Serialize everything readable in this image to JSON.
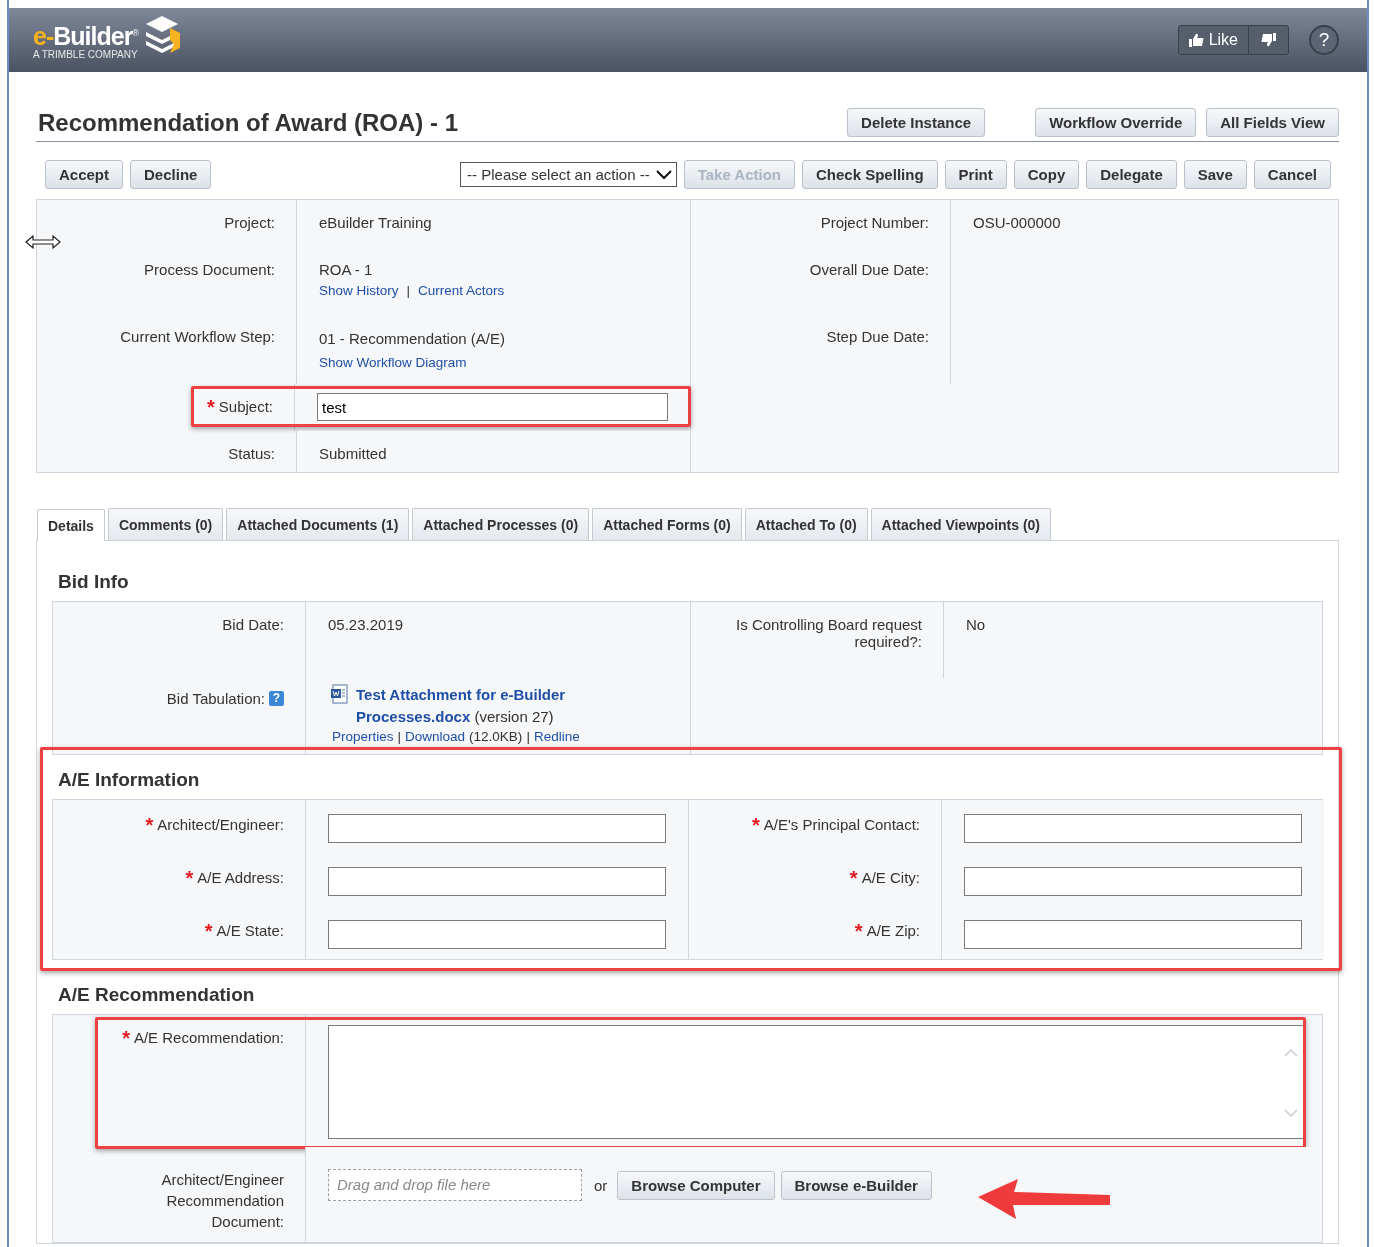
{
  "header": {
    "logo_prefix": "e-",
    "logo_name": "Builder",
    "logo_mark": "®",
    "tagline": "A TRIMBLE COMPANY",
    "like": "Like",
    "help": "?"
  },
  "title": "Recommendation of Award (ROA) - 1",
  "top_buttons": [
    "Delete Instance",
    "Workflow Override",
    "All Fields View"
  ],
  "left_buttons": [
    "Accept",
    "Decline"
  ],
  "action_select": {
    "value": "-- Please select an action --"
  },
  "right_buttons": [
    {
      "label": "Take Action",
      "disabled": true
    },
    {
      "label": "Check Spelling",
      "disabled": false
    },
    {
      "label": "Print",
      "disabled": false
    },
    {
      "label": "Copy",
      "disabled": false
    },
    {
      "label": "Delegate",
      "disabled": false
    },
    {
      "label": "Save",
      "disabled": false
    },
    {
      "label": "Cancel",
      "disabled": false
    }
  ],
  "info": {
    "rows": [
      {
        "pairs": [
          {
            "label": "Project:",
            "kind": "text",
            "value": "eBuilder Training"
          },
          {
            "label": "Project Number:",
            "kind": "text",
            "value": "OSU-000000"
          }
        ]
      },
      {
        "pairs": [
          {
            "label": "Process Document:",
            "kind": "text",
            "value": "ROA - 1",
            "links": [
              "Show History",
              "Current Actors"
            ],
            "separator": "|"
          },
          {
            "label": "Overall Due Date:",
            "kind": "text"
          }
        ]
      },
      {
        "pairs": [
          {
            "label": "Current Workflow Step:",
            "kind": "text",
            "value": "01 - Recommendation (A/E)",
            "inline_link": "Show Workflow Diagram"
          },
          {
            "label": "Step Due Date:",
            "kind": "text"
          }
        ]
      },
      {
        "pairs": [
          {
            "label": "Subject:",
            "kind": "input",
            "required_mark": "*",
            "value": "test",
            "highlighted": true
          }
        ]
      },
      {
        "pairs": [
          {
            "label": "Status:",
            "kind": "text",
            "value": "Submitted"
          }
        ]
      }
    ]
  },
  "tabs": [
    {
      "label": "Details",
      "selected": true
    },
    {
      "label": "Comments (0)",
      "selected": false
    },
    {
      "label": "Attached Documents (1)",
      "selected": false
    },
    {
      "label": "Attached Processes (0)",
      "selected": false
    },
    {
      "label": "Attached Forms (0)",
      "selected": false
    },
    {
      "label": "Attached To (0)",
      "selected": false
    },
    {
      "label": "Attached Viewpoints (0)",
      "selected": false
    }
  ],
  "sections": [
    {
      "title": "Bid Info",
      "rows": [
        {
          "pairs": [
            {
              "label": "Bid Date:",
              "kind": "text",
              "value": "05.23.2019"
            },
            {
              "label": "Is Controlling Board request required?:",
              "kind": "text",
              "value": "No"
            }
          ]
        },
        {
          "pairs": [
            {
              "label": "Bid Tabulation:",
              "help": "?",
              "kind": "attachment",
              "file": "Test Attachment for e-Builder Processes.docx",
              "version": "(version 27)",
              "actions": [
                {
                  "label": "Properties"
                },
                {
                  "label": "Download",
                  "note": "(12.0KB)"
                },
                {
                  "label": "Redline"
                }
              ],
              "separator": "|"
            }
          ]
        }
      ]
    },
    {
      "title": "A/E Information",
      "highlighted": true,
      "rows": [
        {
          "pairs": [
            {
              "label": "Architect/Engineer:",
              "kind": "input",
              "required_mark": "*"
            },
            {
              "label": "A/E's Principal Contact:",
              "kind": "input",
              "required_mark": "*"
            }
          ]
        },
        {
          "pairs": [
            {
              "label": "A/E Address:",
              "kind": "input",
              "required_mark": "*"
            },
            {
              "label": "A/E City:",
              "kind": "input",
              "required_mark": "*"
            }
          ]
        },
        {
          "pairs": [
            {
              "label": "A/E State:",
              "kind": "input",
              "required_mark": "*"
            },
            {
              "label": "A/E Zip:",
              "kind": "input",
              "required_mark": "*"
            }
          ]
        }
      ]
    },
    {
      "title": "A/E Recommendation",
      "rows": [
        {
          "pairs": [
            {
              "label": "A/E Recommendation:",
              "kind": "textarea",
              "required_mark": "*",
              "highlighted": true
            }
          ]
        },
        {
          "pairs": [
            {
              "label": "Architect/Engineer Recommendation Document:",
              "kind": "upload",
              "placeholder": "Drag and drop file here",
              "or": "or",
              "buttons": [
                "Browse Computer",
                "Browse e-Builder"
              ],
              "pointer_arrow": true
            }
          ]
        }
      ]
    }
  ]
}
